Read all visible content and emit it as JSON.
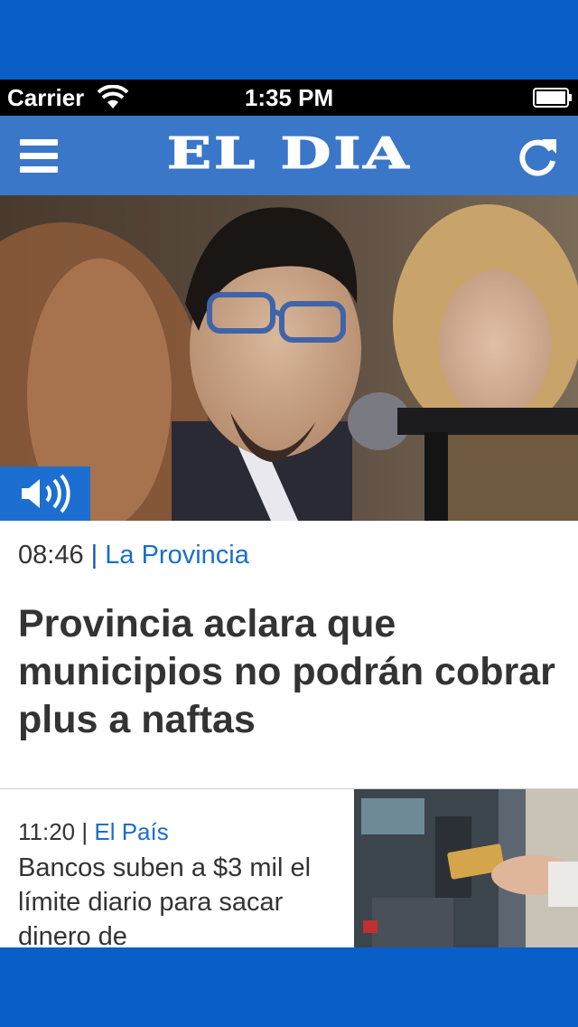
{
  "status_bar": {
    "carrier": "Carrier",
    "time": "1:35 PM"
  },
  "navbar": {
    "logo": "EL DIA",
    "menu_icon": "hamburger-menu-icon",
    "refresh_icon": "refresh-icon"
  },
  "hero": {
    "audio_icon": "speaker-icon"
  },
  "articles": [
    {
      "time": "08:46",
      "separator": "|",
      "section": "La Provincia",
      "headline": "Provincia aclara que municipios no podrán cobrar plus a naftas"
    },
    {
      "time": "11:20",
      "separator": "|",
      "section": "El País",
      "headline": "Bancos suben a $3 mil el límite diario para sacar dinero de"
    }
  ],
  "colors": {
    "frame": "#0a5ec7",
    "navbar": "#3a77c8",
    "accent_link": "#1a6fc8",
    "text": "#333333"
  }
}
